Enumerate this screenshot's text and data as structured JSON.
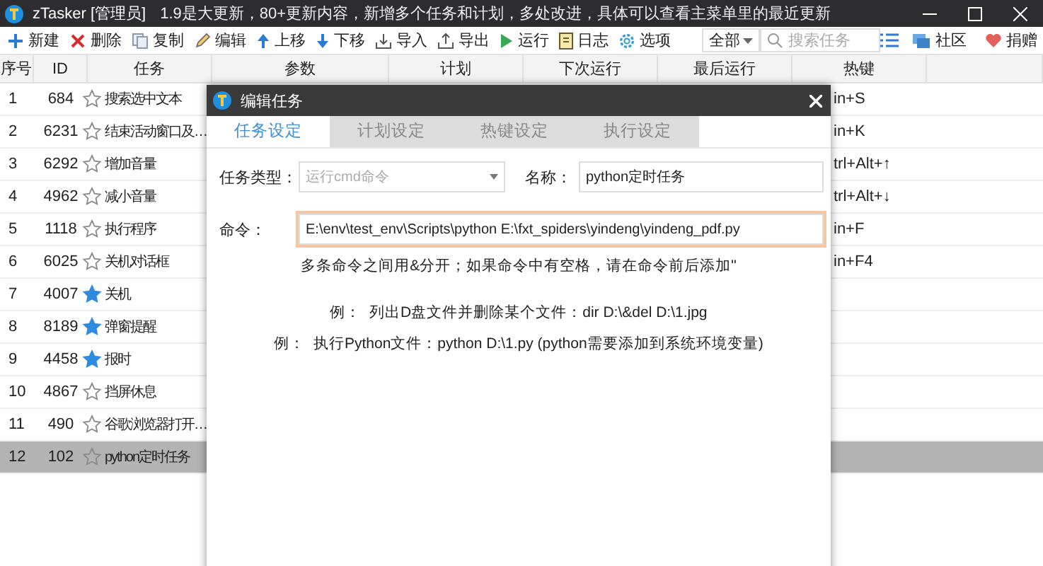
{
  "window": {
    "app_name": "zTasker [管理员]",
    "notice": "1.9是大更新，80+更新内容，新增多个任务和计划，多处改进，具体可以查看主菜单里的最近更新"
  },
  "toolbar": [
    {
      "label": "新建"
    },
    {
      "label": "删除"
    },
    {
      "label": "复制"
    },
    {
      "label": "编辑"
    },
    {
      "label": "上移"
    },
    {
      "label": "下移"
    },
    {
      "label": "导入"
    },
    {
      "label": "导出"
    },
    {
      "label": "运行"
    },
    {
      "label": "日志"
    },
    {
      "label": "选项"
    }
  ],
  "filter": {
    "value": "全部"
  },
  "search": {
    "placeholder": "搜索任务"
  },
  "links": [
    {
      "label": "社区"
    },
    {
      "label": "捐赠"
    }
  ],
  "table": {
    "columns": [
      "序号",
      "ID",
      "任务",
      "参数",
      "计划",
      "下次运行",
      "最后运行",
      "热键"
    ],
    "rows": [
      {
        "no": "1",
        "id": "684",
        "task": "搜索选中文本",
        "starred": false,
        "hotkey": "in+S",
        "selected": false
      },
      {
        "no": "2",
        "id": "6231",
        "task": "结束活动窗口及…",
        "starred": false,
        "hotkey": "in+K",
        "selected": false
      },
      {
        "no": "3",
        "id": "6292",
        "task": "增加音量",
        "starred": false,
        "hotkey": "trl+Alt+↑",
        "selected": false
      },
      {
        "no": "4",
        "id": "4962",
        "task": "减小音量",
        "starred": false,
        "hotkey": "trl+Alt+↓",
        "selected": false
      },
      {
        "no": "5",
        "id": "1118",
        "task": "执行程序",
        "starred": false,
        "hotkey": "in+F",
        "selected": false
      },
      {
        "no": "6",
        "id": "6025",
        "task": "关机对话框",
        "starred": false,
        "hotkey": "in+F4",
        "selected": false
      },
      {
        "no": "7",
        "id": "4007",
        "task": "关机",
        "starred": true,
        "selected": false
      },
      {
        "no": "8",
        "id": "8189",
        "task": "弹窗提醒",
        "starred": true,
        "selected": false
      },
      {
        "no": "9",
        "id": "4458",
        "task": "报时",
        "starred": true,
        "selected": false
      },
      {
        "no": "10",
        "id": "4867",
        "task": "挡屏休息",
        "starred": false,
        "selected": false
      },
      {
        "no": "11",
        "id": "490",
        "task": "谷歌浏览器打开…",
        "starred": false,
        "selected": false
      },
      {
        "no": "12",
        "id": "102",
        "task": "python定时任务",
        "starred": false,
        "selected": true
      }
    ]
  },
  "dialog": {
    "title": "编辑任务",
    "tabs": [
      {
        "label": "任务设定",
        "selected": true
      },
      {
        "label": "计划设定",
        "selected": false
      },
      {
        "label": "热键设定",
        "selected": false
      },
      {
        "label": "执行设定",
        "selected": false
      }
    ],
    "task_type": {
      "label": "任务类型：",
      "value": "运行cmd命令",
      "disabled": true
    },
    "name": {
      "label": "名称：",
      "value": "python定时任务"
    },
    "command": {
      "label": "命令：",
      "value": "E:\\env\\test_env\\Scripts\\python  E:\\fxt_spiders\\yindeng\\yindeng_pdf.py",
      "highlighted": true
    },
    "notes": [
      "多条命令之间用&分开；如果命令中有空格，请在命令前后添加\"",
      "例：  列出D盘文件并删除某个文件：dir D:\\&del D:\\1.jpg",
      "例：  执行Python文件：python D:\\1.py (python需要添加到系统环境变量)"
    ]
  }
}
